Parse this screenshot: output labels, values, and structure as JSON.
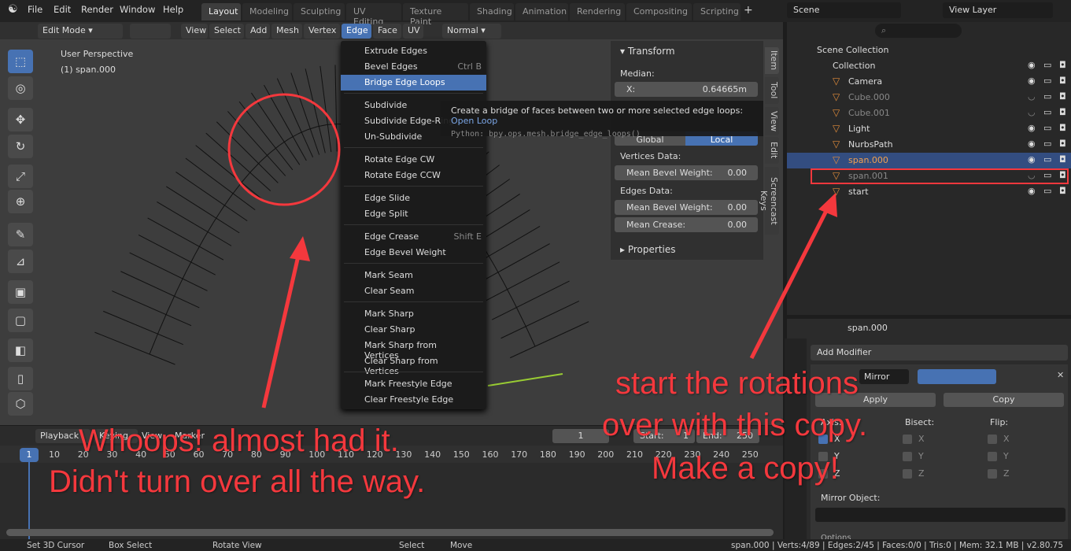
{
  "topbar": {
    "menus": [
      "File",
      "Edit",
      "Render",
      "Window",
      "Help"
    ],
    "workspaces": [
      "Layout",
      "Modeling",
      "Sculpting",
      "UV Editing",
      "Texture Paint",
      "Shading",
      "Animation",
      "Rendering",
      "Compositing",
      "Scripting"
    ],
    "active_workspace": "Layout",
    "scene": "Scene",
    "view_layer": "View Layer"
  },
  "header": {
    "mode": "Edit Mode",
    "menus": [
      "View",
      "Select",
      "Add",
      "Mesh",
      "Vertex",
      "Edge",
      "Face",
      "UV"
    ],
    "active_menu": "Edge",
    "orientation": "Normal"
  },
  "viewport": {
    "view_name": "User Perspective",
    "object_label": "(1) span.000"
  },
  "edge_menu": {
    "items": [
      {
        "label": "Extrude Edges",
        "shortcut": ""
      },
      {
        "label": "Bevel Edges",
        "shortcut": "Ctrl B"
      },
      {
        "label": "Bridge Edge Loops",
        "shortcut": "",
        "highlighted": true
      },
      {
        "label": "Subdivide",
        "shortcut": ""
      },
      {
        "label": "Subdivide Edge-Ring",
        "shortcut": ""
      },
      {
        "label": "Un-Subdivide",
        "shortcut": ""
      },
      {
        "label": "Rotate Edge CW",
        "shortcut": ""
      },
      {
        "label": "Rotate Edge CCW",
        "shortcut": ""
      },
      {
        "label": "Edge Slide",
        "shortcut": ""
      },
      {
        "label": "Edge Split",
        "shortcut": ""
      },
      {
        "label": "Edge Crease",
        "shortcut": "Shift E"
      },
      {
        "label": "Edge Bevel Weight",
        "shortcut": ""
      },
      {
        "label": "Mark Seam",
        "shortcut": ""
      },
      {
        "label": "Clear Seam",
        "shortcut": ""
      },
      {
        "label": "Mark Sharp",
        "shortcut": ""
      },
      {
        "label": "Clear Sharp",
        "shortcut": ""
      },
      {
        "label": "Mark Sharp from Vertices",
        "shortcut": ""
      },
      {
        "label": "Clear Sharp from Vertices",
        "shortcut": ""
      },
      {
        "label": "Mark Freestyle Edge",
        "shortcut": ""
      },
      {
        "label": "Clear Freestyle Edge",
        "shortcut": ""
      }
    ]
  },
  "tooltip": {
    "text": "Create a bridge of faces between two or more selected edge loops:",
    "value": "Open Loop",
    "python": "Python: bpy.ops.mesh.bridge_edge_loops()"
  },
  "npanel": {
    "transform": "Transform",
    "median": "Median:",
    "x_label": "X:",
    "x_value": "0.64665m",
    "global": "Global",
    "local": "Local",
    "vertices_data": "Vertices Data:",
    "v_bevel_label": "Mean Bevel Weight:",
    "v_bevel": "0.00",
    "edges_data": "Edges Data:",
    "e_bevel_label": "Mean Bevel Weight:",
    "e_bevel": "0.00",
    "crease_label": "Mean Crease:",
    "crease": "0.00",
    "properties": "Properties",
    "tabs": [
      "Item",
      "Tool",
      "View",
      "Edit",
      "Screencast Keys"
    ]
  },
  "outliner": {
    "search_placeholder": "",
    "root": "Scene Collection",
    "items": [
      {
        "name": "Collection",
        "dim": false,
        "selected": false
      },
      {
        "name": "Camera",
        "dim": false,
        "selected": false
      },
      {
        "name": "Cube.000",
        "dim": true,
        "selected": false
      },
      {
        "name": "Cube.001",
        "dim": true,
        "selected": false
      },
      {
        "name": "Light",
        "dim": false,
        "selected": false
      },
      {
        "name": "NurbsPath",
        "dim": false,
        "selected": false
      },
      {
        "name": "span.000",
        "dim": false,
        "selected": true
      },
      {
        "name": "span.001",
        "dim": true,
        "selected": false
      },
      {
        "name": "start",
        "dim": false,
        "selected": false
      }
    ]
  },
  "properties": {
    "object": "span.000",
    "add_modifier": "Add Modifier",
    "modifier_name": "Mirror",
    "apply": "Apply",
    "copy": "Copy",
    "axis": "Axis:",
    "bisect": "Bisect:",
    "flip": "Flip:",
    "axes": [
      "X",
      "Y",
      "Z"
    ],
    "axis_checked": [
      true,
      false,
      false
    ],
    "mirror_object": "Mirror Object:",
    "options": "Options"
  },
  "timeline": {
    "playback": "Playback",
    "keying": "Keying",
    "view": "View",
    "marker": "Marker",
    "current_frame": "1",
    "start_label": "Start:",
    "start": "1",
    "end_label": "End:",
    "end": "250",
    "ticks": [
      "10",
      "20",
      "30",
      "40",
      "50",
      "60",
      "70",
      "80",
      "90",
      "100",
      "110",
      "120",
      "130",
      "140",
      "150",
      "160",
      "170",
      "180",
      "190",
      "200",
      "210",
      "220",
      "230",
      "240",
      "250"
    ]
  },
  "status": {
    "hints": [
      "Set 3D Cursor",
      "Box Select",
      "Rotate View",
      "Select",
      "Move"
    ],
    "info": "span.000 | Verts:4/89 | Edges:2/45 | Faces:0/0 | Tris:0 | Mem: 32.1 MB | v2.80.75"
  },
  "annotations": {
    "left_line1": "Whoops! almost had it.",
    "left_line2": "Didn't turn over all the way.",
    "right_line1": "start the rotations",
    "right_line2": "over with this copy.",
    "right_line3": "Make a copy!",
    "color": "#f4383d"
  },
  "colors": {
    "accent": "#4772b3",
    "object_orange": "#e08b3a"
  }
}
